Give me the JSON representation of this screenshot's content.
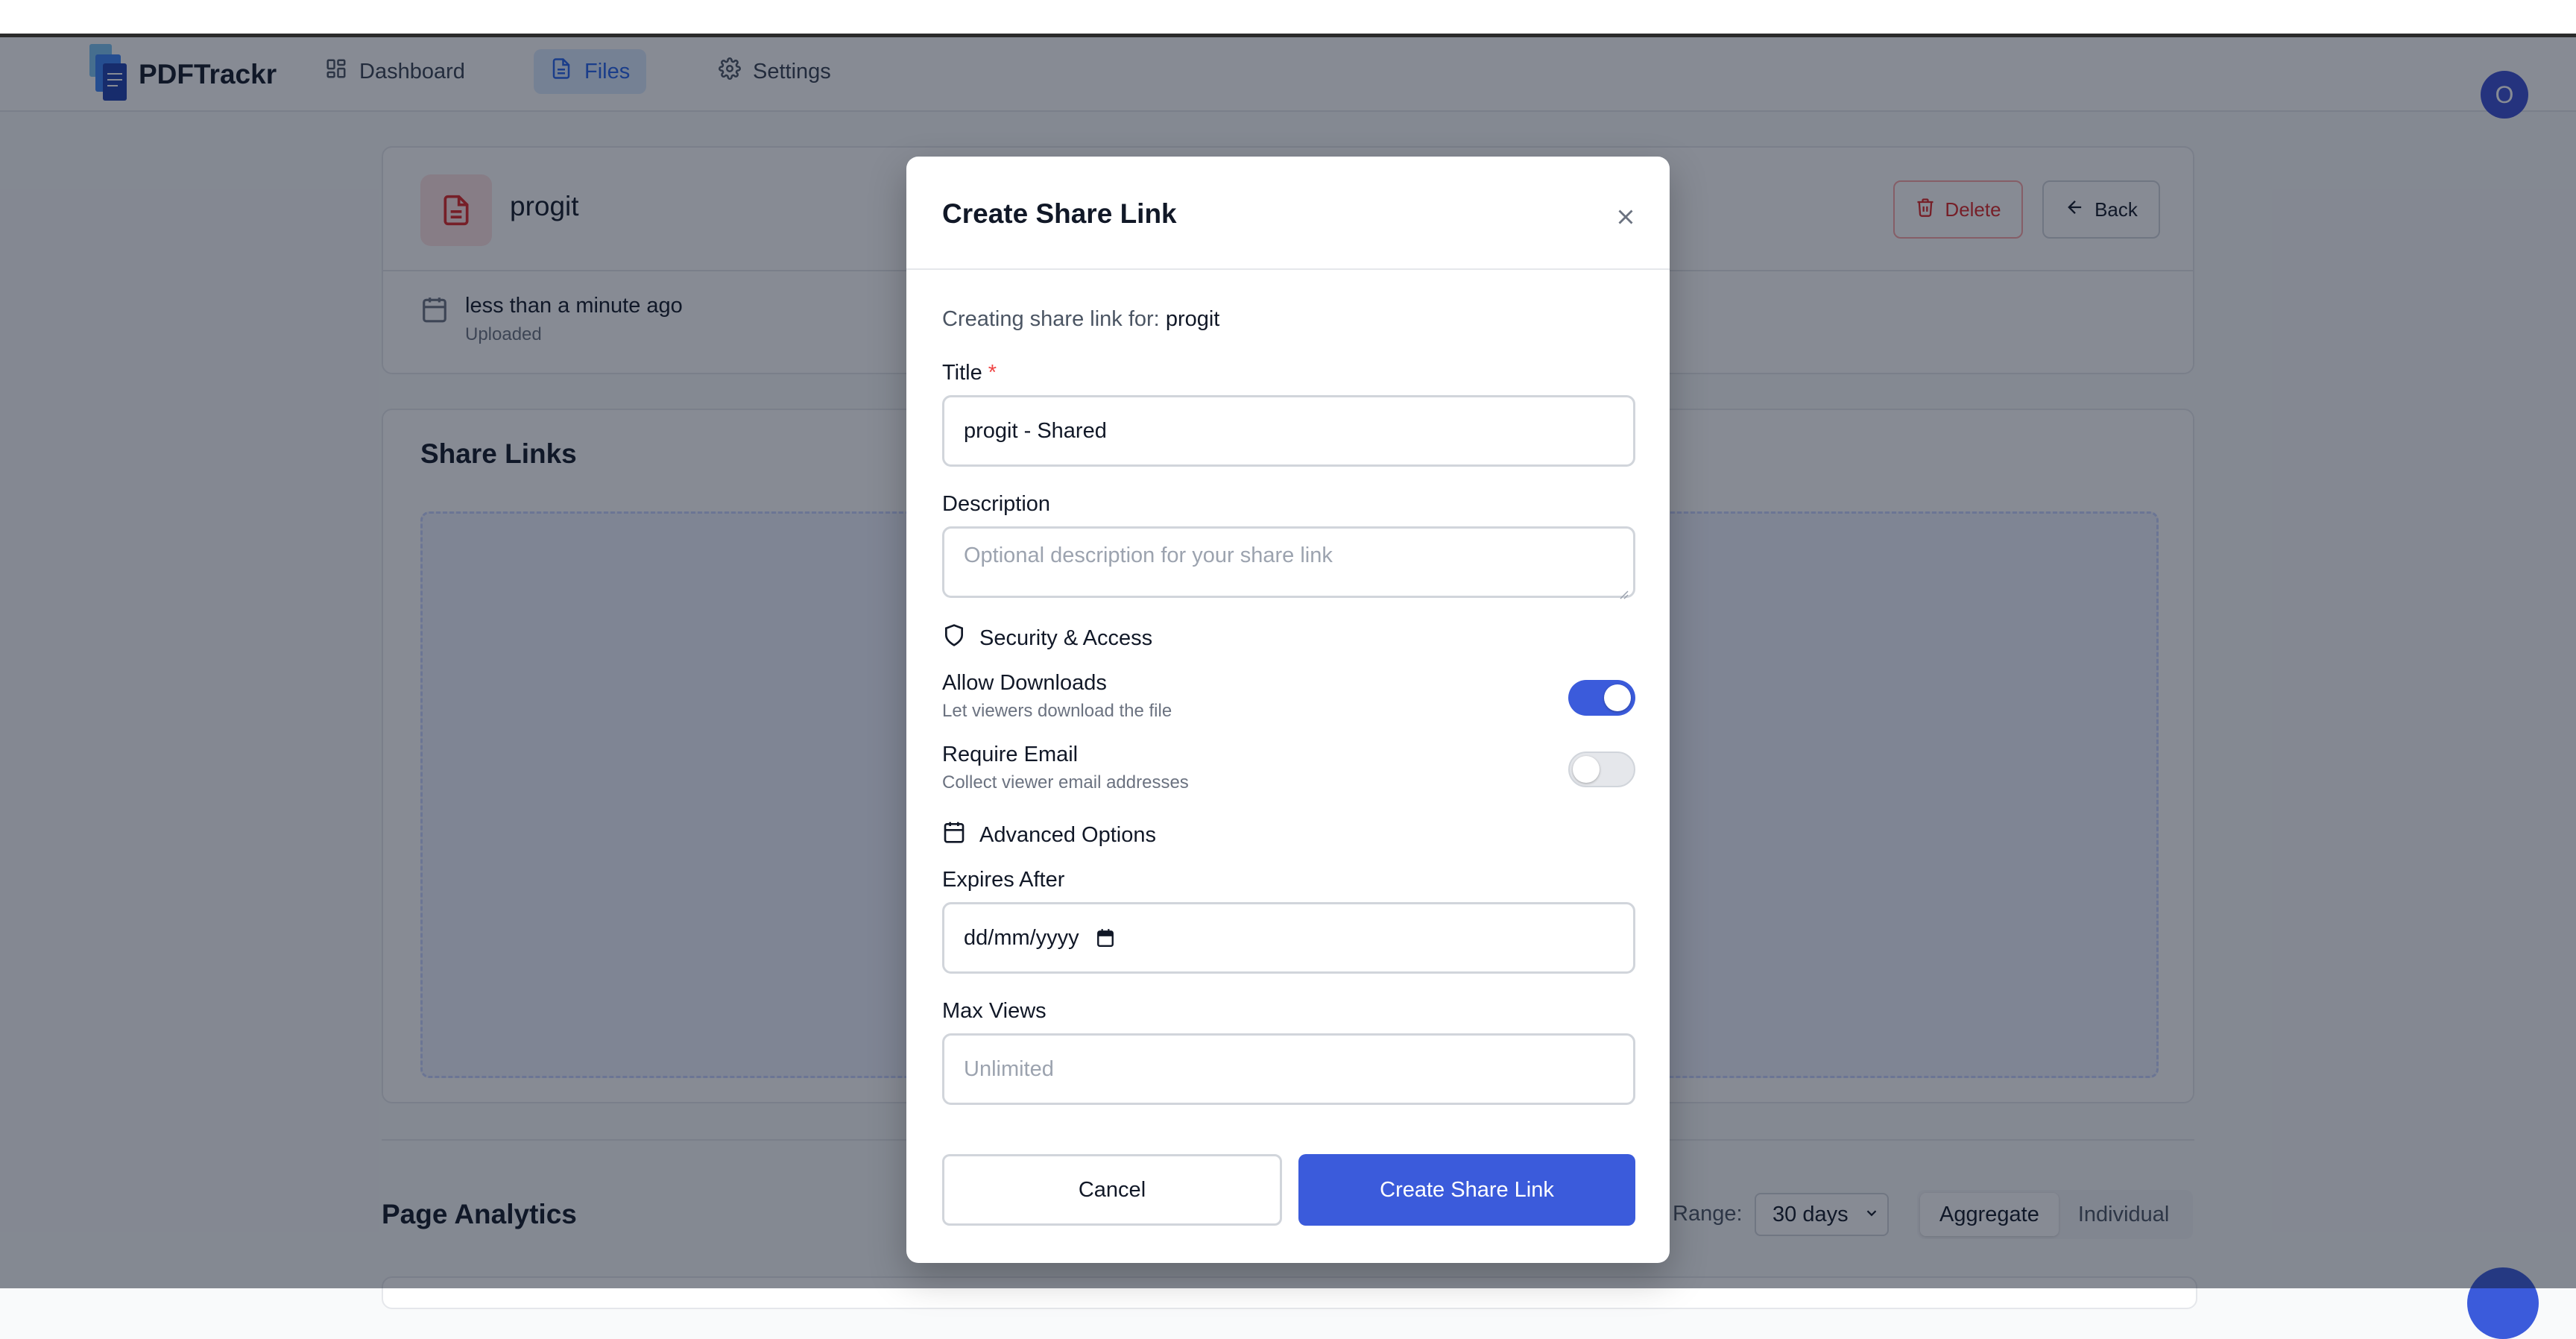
{
  "app": {
    "brand": "PDFTrackr",
    "nav": [
      {
        "label": "Dashboard",
        "icon": "grid-icon"
      },
      {
        "label": "Files",
        "icon": "file-icon",
        "active": true
      },
      {
        "label": "Settings",
        "icon": "gear-icon"
      }
    ],
    "avatar_initial": "O"
  },
  "file": {
    "name": "progit",
    "uploaded_time": "less than a minute ago",
    "uploaded_label": "Uploaded",
    "delete_label": "Delete",
    "back_label": "Back"
  },
  "share_links": {
    "title": "Share Links"
  },
  "analytics": {
    "title": "Page Analytics",
    "range_label": "Range:",
    "range_value": "30 days",
    "modes": [
      "Aggregate",
      "Individual"
    ],
    "active_mode": "Aggregate"
  },
  "modal": {
    "title": "Create Share Link",
    "creating_prefix": "Creating share link for:",
    "creating_file": "progit",
    "title_label": "Title",
    "required_mark": "*",
    "title_value": "progit - Shared",
    "description_label": "Description",
    "description_placeholder": "Optional description for your share link",
    "security_heading": "Security & Access",
    "allow_downloads_label": "Allow Downloads",
    "allow_downloads_desc": "Let viewers download the file",
    "allow_downloads_on": true,
    "require_email_label": "Require Email",
    "require_email_desc": "Collect viewer email addresses",
    "require_email_on": false,
    "advanced_heading": "Advanced Options",
    "expires_label": "Expires After",
    "expires_placeholder": "dd/mm/yyyy",
    "max_views_label": "Max Views",
    "max_views_placeholder": "Unlimited",
    "cancel_label": "Cancel",
    "create_label": "Create Share Link"
  },
  "colors": {
    "primary": "#3b5bdb",
    "danger": "#dc2626",
    "overlay": "rgba(15,23,42,0.5)"
  }
}
